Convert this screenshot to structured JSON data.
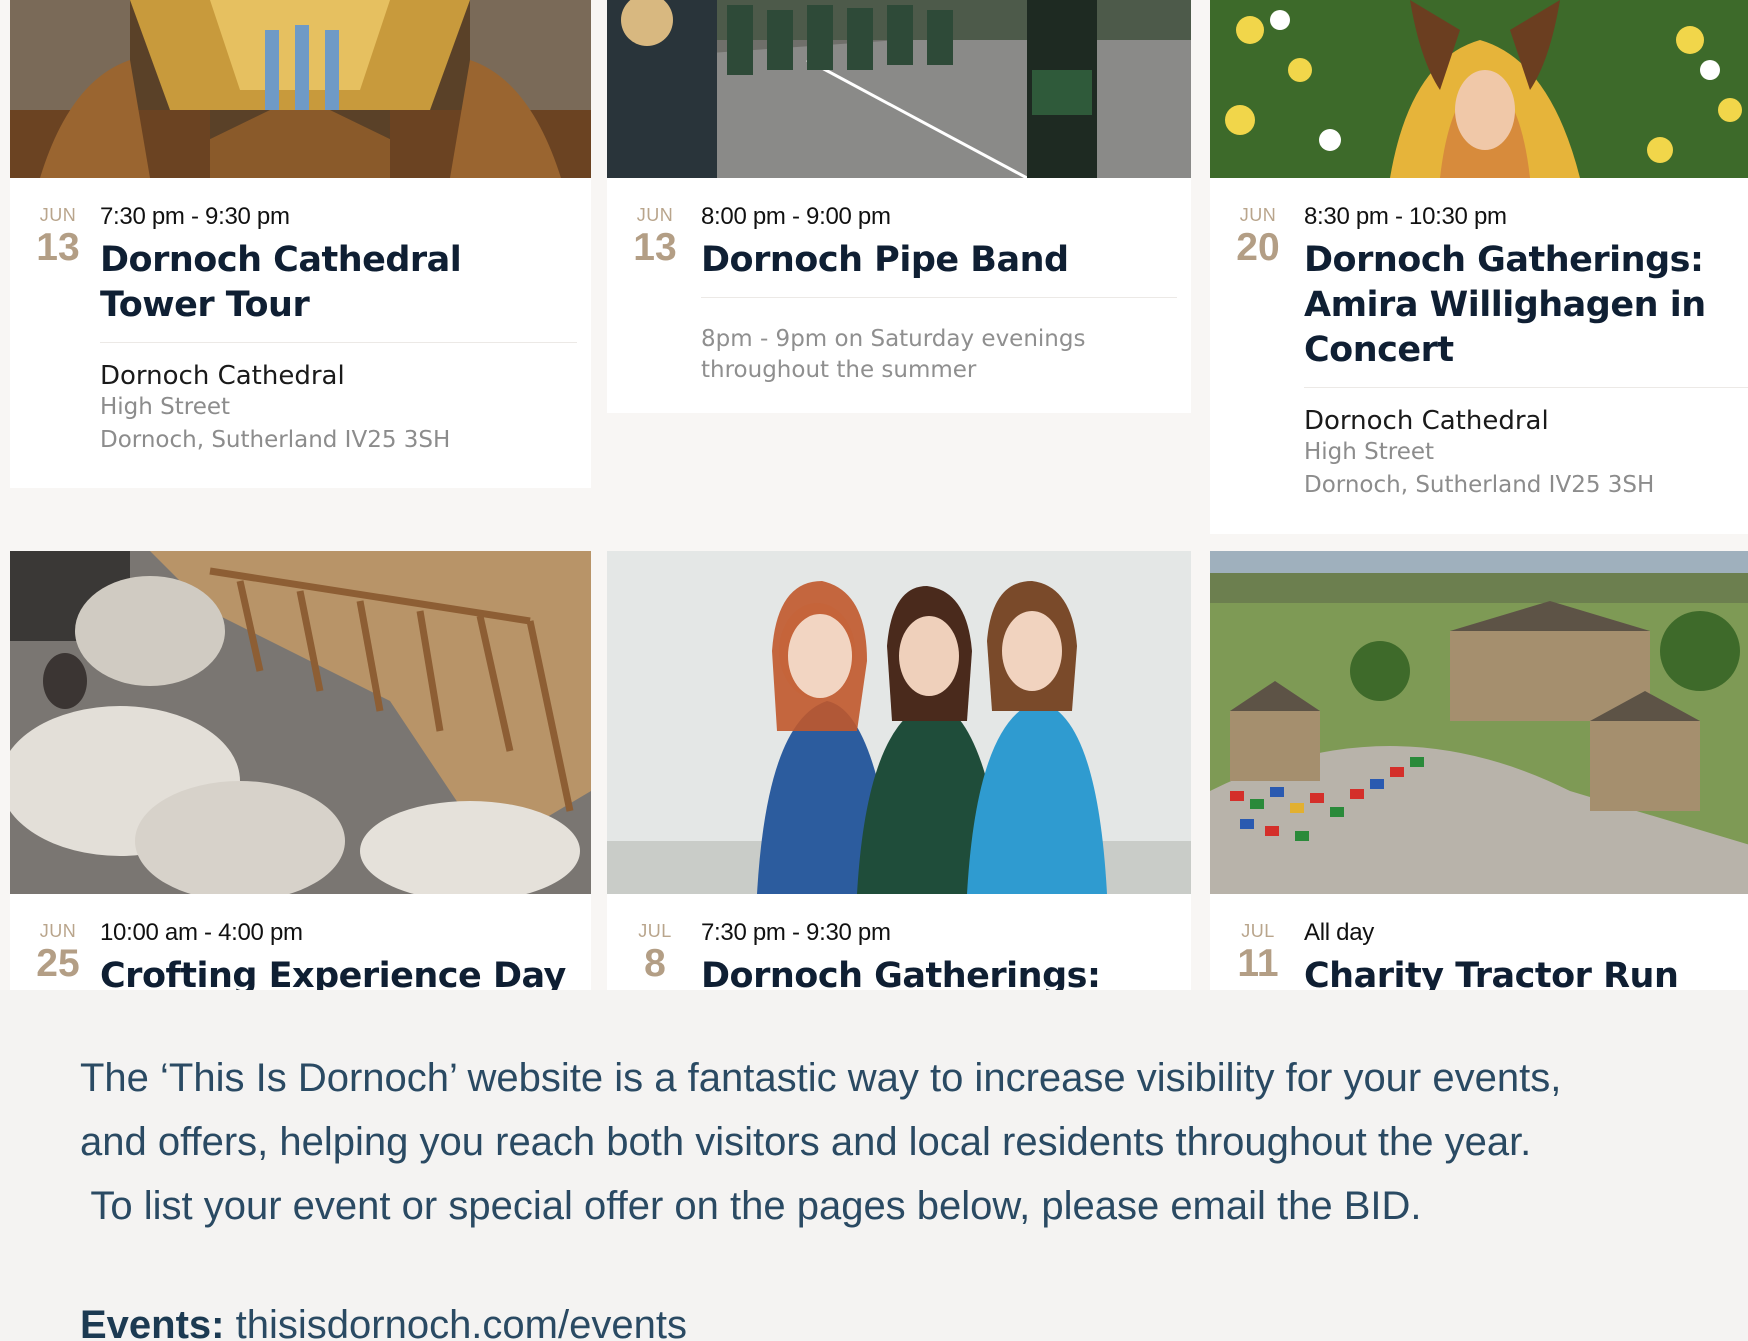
{
  "events": [
    {
      "month": "JUN",
      "day": "13",
      "time": "7:30 pm - 9:30 pm",
      "title_lines": [
        "Dornoch Cathedral",
        "Tower Tour"
      ],
      "venue": "Dornoch Cathedral",
      "address1": "High Street",
      "address2": "Dornoch, Sutherland IV25 3SH",
      "image": "cathedral-interior"
    },
    {
      "month": "JUN",
      "day": "13",
      "time": "8:00 pm - 9:00 pm",
      "title_lines": [
        "Dornoch Pipe Band"
      ],
      "description_lines": [
        "8pm - 9pm on Saturday evenings",
        "throughout the summer"
      ],
      "image": "pipe-band-parade"
    },
    {
      "month": "JUN",
      "day": "20",
      "time": "8:30 pm - 10:30 pm",
      "title_lines": [
        "Dornoch Gatherings:",
        "Amira Willighagen in",
        "Concert"
      ],
      "venue": "Dornoch Cathedral",
      "address1": "High Street",
      "address2": "Dornoch, Sutherland IV25 3SH",
      "image": "singer-in-flowers"
    },
    {
      "month": "JUN",
      "day": "25",
      "time": "10:00 am - 4:00 pm",
      "title_lines": [
        "Crofting Experience Day"
      ],
      "image": "sheep-at-hay-rack"
    },
    {
      "month": "JUL",
      "day": "8",
      "time": "7:30 pm - 9:30 pm",
      "title_lines": [
        "Dornoch Gatherings:"
      ],
      "image": "three-women-portrait"
    },
    {
      "month": "JUL",
      "day": "11",
      "time": "All day",
      "title_lines": [
        "Charity Tractor Run"
      ],
      "image": "tractors-aerial-town"
    }
  ],
  "intro": {
    "lines": [
      "The ‘This Is Dornoch’ website is a fantastic way to increase visibility for your events,",
      "and offers, helping you reach both visitors and local residents throughout the year.",
      " To list your event or special offer on the pages below, please email the BID."
    ],
    "events_label": "Events:",
    "events_url": "thisisdornoch.com/events"
  },
  "colors": {
    "page_bg": "#f4f3f2",
    "date_accent": "#b39e85",
    "title": "#0f1f33",
    "intro_text": "#2a4a63"
  }
}
